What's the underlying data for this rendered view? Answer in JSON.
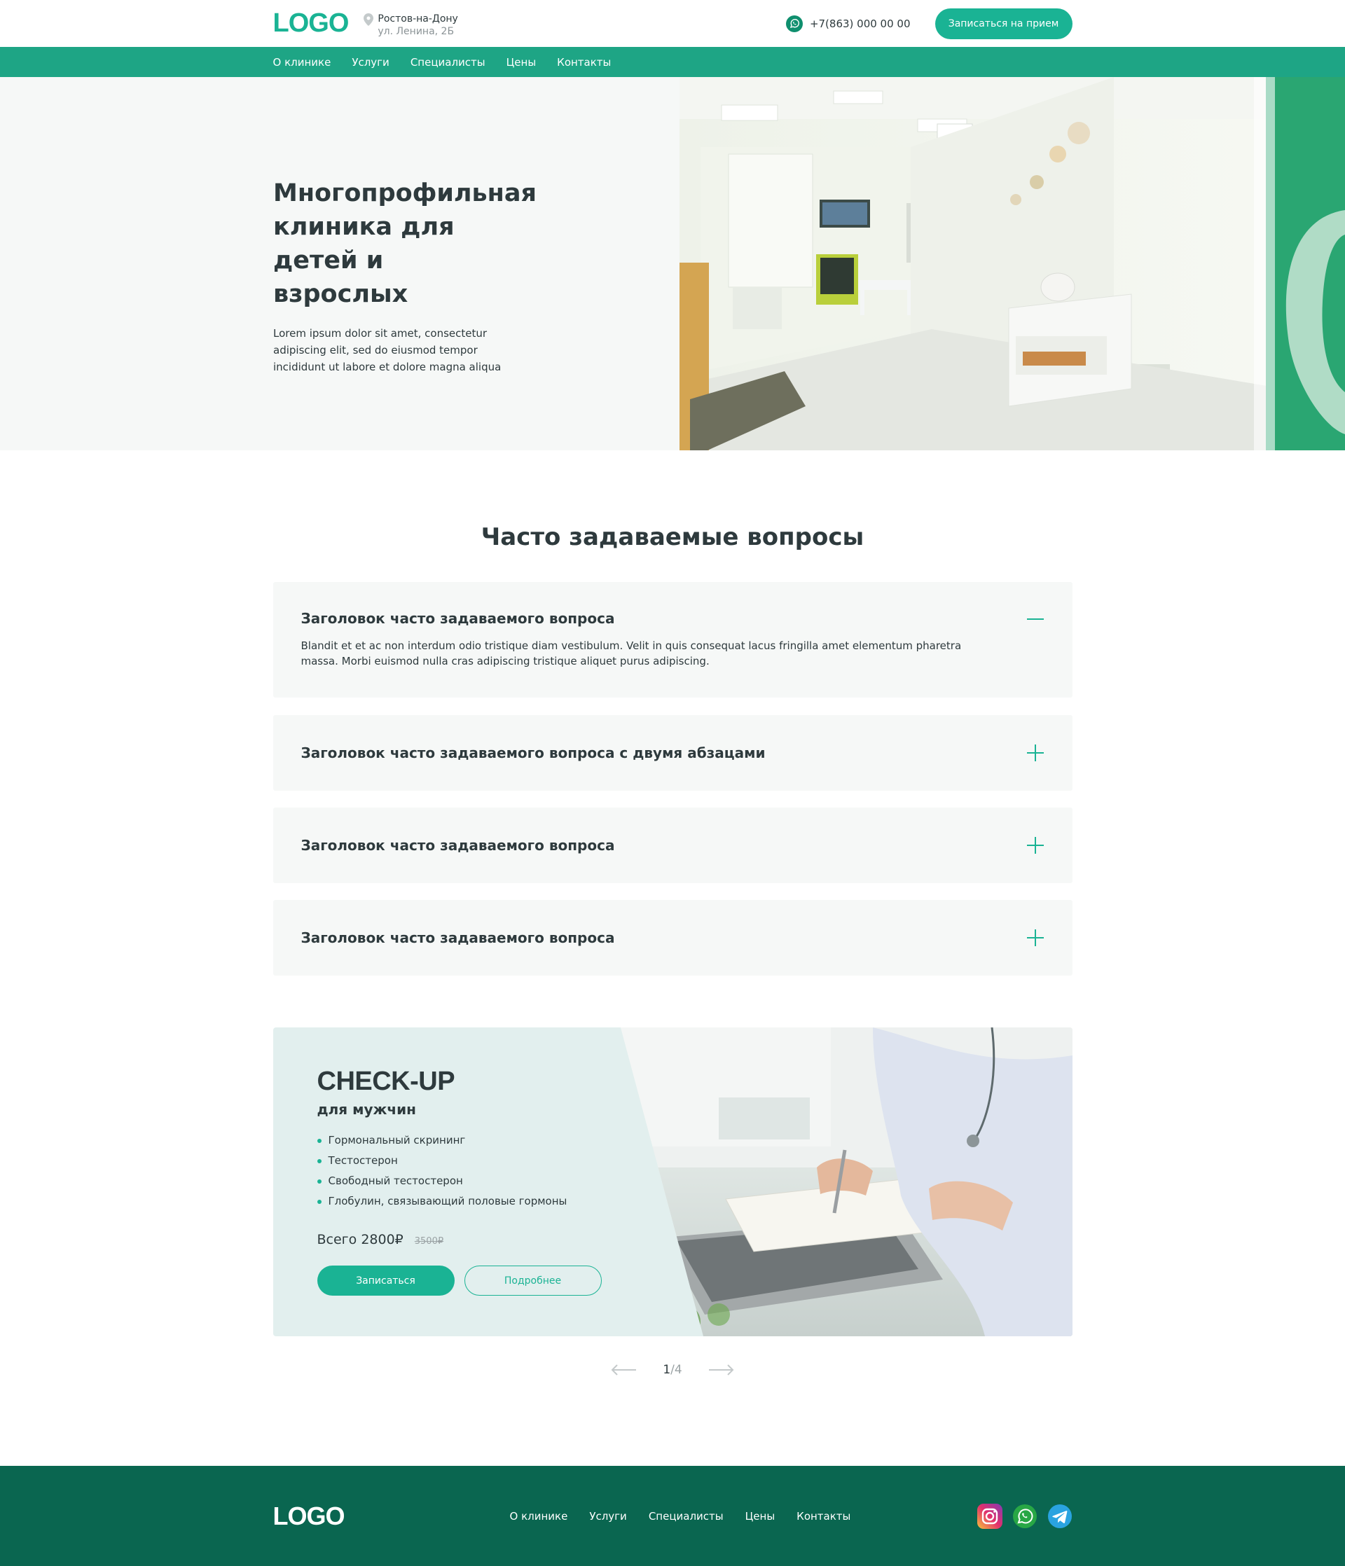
{
  "header": {
    "logo": "LOGO",
    "city": "Ростов-на-Дону",
    "street": "ул. Ленина, 2Б",
    "phone": "+7(863) 000 00 00",
    "book_label": "Записаться на прием"
  },
  "nav": [
    "О клинике",
    "Услуги",
    "Специалисты",
    "Цены",
    "Контакты"
  ],
  "hero": {
    "title": "Многопрофильная клиника для детей и взрослых",
    "description": "Lorem ipsum dolor sit amet, consectetur adipiscing elit, sed do eiusmod tempor incididunt ut labore et dolore magna aliqua"
  },
  "faq": {
    "title": "Часто задаваемые вопросы",
    "items": [
      {
        "question": "Заголовок часто задаваемого вопроса",
        "answer": "Blandit et et ac non interdum odio tristique diam vestibulum. Velit in quis consequat lacus fringilla amet elementum pharetra massa. Morbi euismod nulla cras adipiscing tristique aliquet purus adipiscing.",
        "open": true
      },
      {
        "question": "Заголовок часто задаваемого вопроса с двумя абзацами",
        "open": false
      },
      {
        "question": "Заголовок часто задаваемого вопроса",
        "open": false
      },
      {
        "question": "Заголовок часто задаваемого вопроса",
        "open": false
      }
    ]
  },
  "promo": {
    "title": "CHECK-UP",
    "subtitle": "для мужчин",
    "items": [
      "Гормональный скрининг",
      "Тестостерон",
      "Свободный тестостерон",
      "Глобулин, связывающий половые гормоны"
    ],
    "price": "Всего 2800₽",
    "old_price": "3500₽",
    "primary_label": "Записаться",
    "secondary_label": "Подробнее"
  },
  "pager": {
    "current": "1",
    "total": "/4"
  },
  "footer": {
    "logo": "LOGO",
    "nav": [
      "О клинике",
      "Услуги",
      "Специалисты",
      "Цены",
      "Контакты"
    ],
    "socials": [
      "instagram-icon",
      "whatsapp-icon",
      "telegram-icon"
    ]
  },
  "colors": {
    "accent": "#1ab394",
    "nav_bg": "#1ea585",
    "footer_bg": "#0a6650",
    "card_bg": "#f6f8f7",
    "promo_bg": "#e2efee"
  }
}
